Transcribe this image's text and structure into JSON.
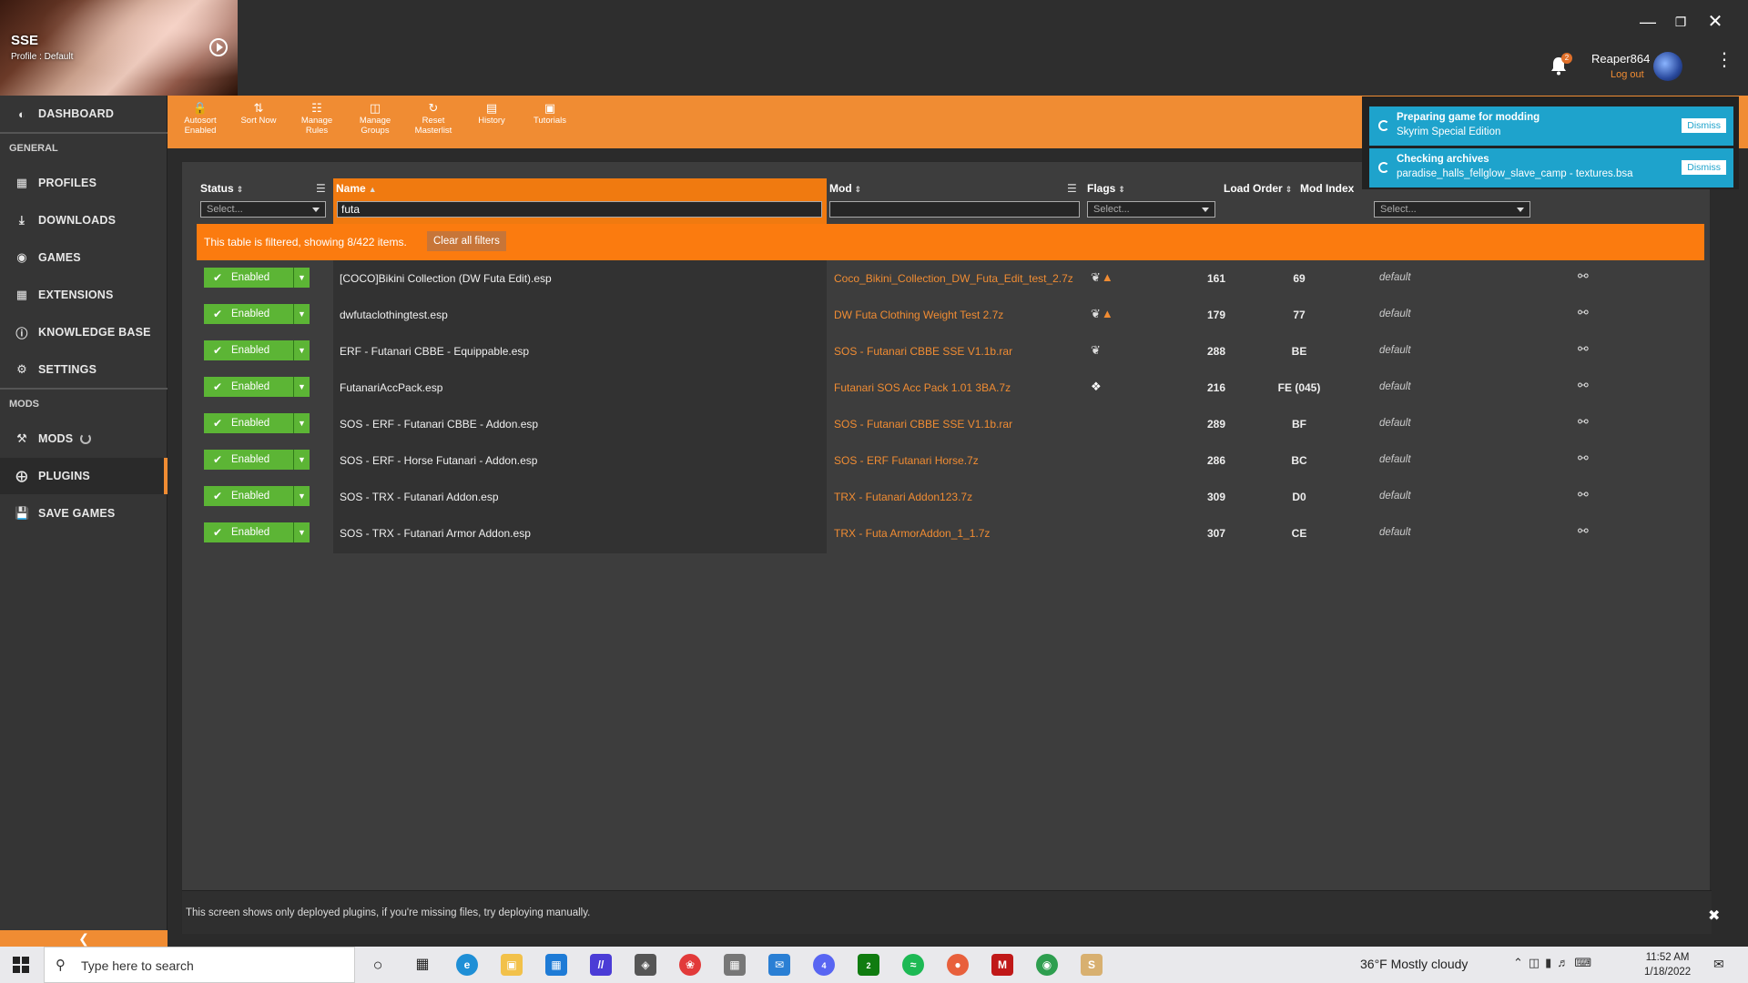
{
  "window": {
    "game_short": "SSE",
    "profile": "Profile : Default",
    "user_name": "Reaper864",
    "logout_label": "Log out",
    "notification_count": "2"
  },
  "sidebar": {
    "dashboard": "DASHBOARD",
    "section_general": "GENERAL",
    "profiles": "PROFILES",
    "downloads": "DOWNLOADS",
    "games": "GAMES",
    "extensions": "EXTENSIONS",
    "knowledge_base": "KNOWLEDGE BASE",
    "settings": "SETTINGS",
    "section_mods": "MODS",
    "mods": "MODS",
    "plugins": "PLUGINS",
    "save_games": "SAVE GAMES"
  },
  "toolbar": {
    "autosort_line1": "Autosort",
    "autosort_line2": "Enabled",
    "sort_now": "Sort Now",
    "manage_rules_1": "Manage",
    "manage_rules_2": "Rules",
    "manage_groups_1": "Manage",
    "manage_groups_2": "Groups",
    "reset_masterlist_1": "Reset",
    "reset_masterlist_2": "Masterlist",
    "history": "History",
    "tutorials": "Tutorials"
  },
  "table": {
    "headers": {
      "status": "Status",
      "name": "Name",
      "mod": "Mod",
      "flags": "Flags",
      "load_order": "Load Order",
      "mod_index": "Mod Index"
    },
    "filters": {
      "status_placeholder": "Select...",
      "name_value": "futa",
      "mod_value": "",
      "flags_placeholder": "Select...",
      "group_placeholder": "Select..."
    },
    "filter_banner": "This table is filtered, showing 8/422 items.",
    "clear_filters": "Clear all filters",
    "rows": [
      {
        "status": "Enabled",
        "name": "[COCO]Bikini Collection (DW Futa Edit).esp",
        "mod": "Coco_Bikini_Collection_DW_Futa_Edit_test_2.7z",
        "flag_icons": "feather-icon,warning-icon",
        "load_order": "161",
        "mod_index": "69",
        "group": "default"
      },
      {
        "status": "Enabled",
        "name": "dwfutaclothingtest.esp",
        "mod": "DW Futa Clothing Weight Test 2.7z",
        "flag_icons": "feather-icon,warning-icon",
        "load_order": "179",
        "mod_index": "77",
        "group": "default"
      },
      {
        "status": "Enabled",
        "name": "ERF - Futanari CBBE - Equippable.esp",
        "mod": "SOS - Futanari CBBE SSE V1.1b.rar",
        "flag_icons": "feather-icon",
        "load_order": "288",
        "mod_index": "BE",
        "group": "default"
      },
      {
        "status": "Enabled",
        "name": "FutanariAccPack.esp",
        "mod": "Futanari SOS Acc Pack 1.01 3BA.7z",
        "flag_icons": "feather-filled-icon",
        "load_order": "216",
        "mod_index": "FE (045)",
        "group": "default"
      },
      {
        "status": "Enabled",
        "name": "SOS - ERF - Futanari CBBE - Addon.esp",
        "mod": "SOS - Futanari CBBE SSE V1.1b.rar",
        "flag_icons": "",
        "load_order": "289",
        "mod_index": "BF",
        "group": "default"
      },
      {
        "status": "Enabled",
        "name": "SOS - ERF - Horse Futanari - Addon.esp",
        "mod": "SOS - ERF Futanari Horse.7z",
        "flag_icons": "",
        "load_order": "286",
        "mod_index": "BC",
        "group": "default"
      },
      {
        "status": "Enabled",
        "name": "SOS - TRX - Futanari Addon.esp",
        "mod": "TRX - Futanari Addon123.7z",
        "flag_icons": "",
        "load_order": "309",
        "mod_index": "D0",
        "group": "default"
      },
      {
        "status": "Enabled",
        "name": "SOS - TRX - Futanari Armor Addon.esp",
        "mod": "TRX - Futa ArmorAddon_1_1.7z",
        "flag_icons": "",
        "load_order": "307",
        "mod_index": "CE",
        "group": "default"
      }
    ],
    "footer_note": "This screen shows only deployed plugins, if you're missing files, try deploying manually."
  },
  "notifications": [
    {
      "title": "Preparing game for modding",
      "subtitle": "Skyrim Special Edition",
      "dismiss": "Dismiss"
    },
    {
      "title": "Checking archives",
      "subtitle": "paradise_halls_fellglow_slave_camp - textures.bsa",
      "dismiss": "Dismiss"
    }
  ],
  "taskbar": {
    "search_placeholder": "Type here to search",
    "weather": "36°F  Mostly cloudy",
    "time": "11:52 AM",
    "date": "1/18/2022",
    "mail_badge": "4",
    "xbox_badge": "2",
    "notify_count": "1"
  },
  "colors": {
    "accent": "#f08c33",
    "banner": "#fb7b0f",
    "enabled": "#5cb535",
    "notification": "#1ea3cc"
  }
}
